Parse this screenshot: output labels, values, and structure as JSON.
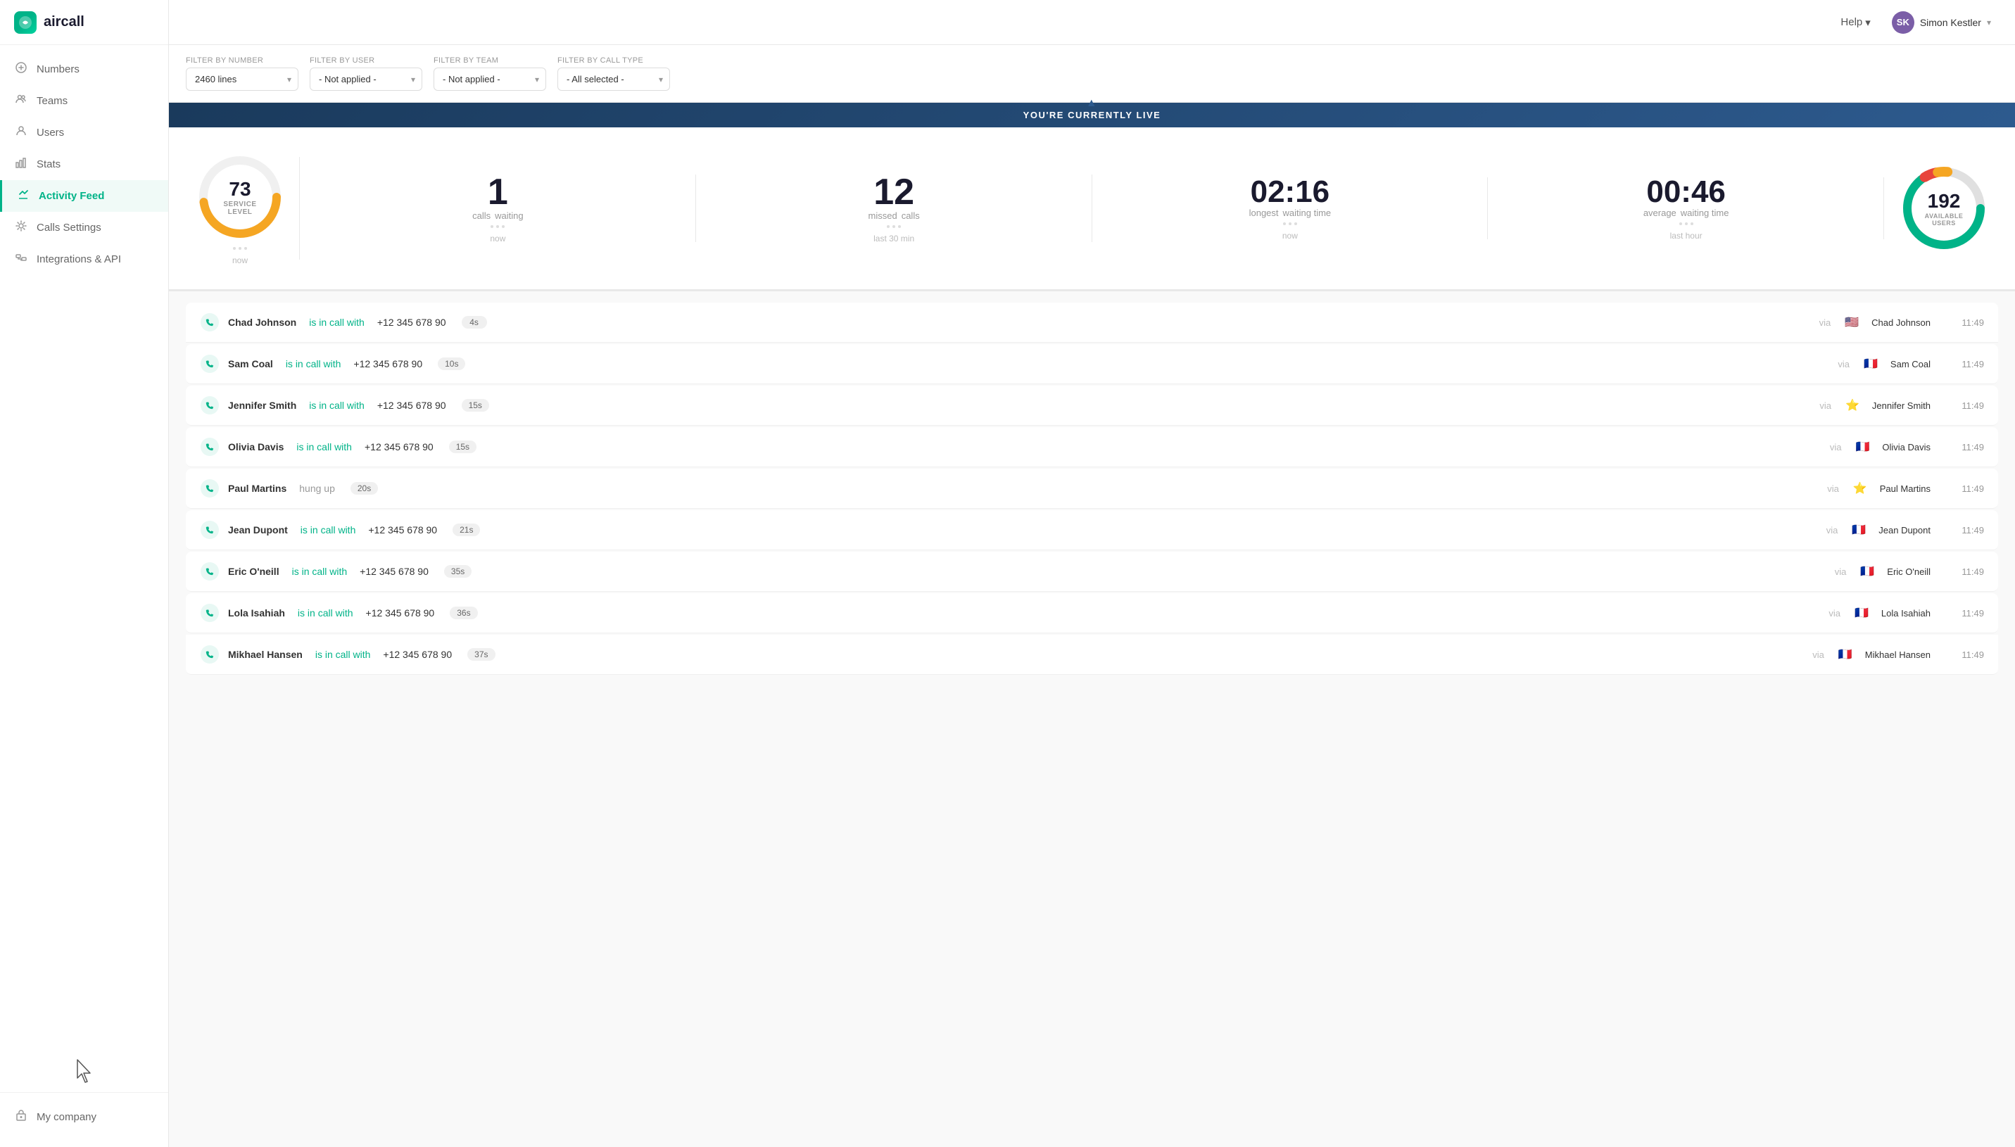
{
  "app": {
    "name": "aircall"
  },
  "topbar": {
    "help_label": "Help",
    "user_initials": "SK",
    "user_name": "Simon Kestler"
  },
  "sidebar": {
    "items": [
      {
        "id": "numbers",
        "label": "Numbers",
        "icon": "📞"
      },
      {
        "id": "teams",
        "label": "Teams",
        "icon": "👥"
      },
      {
        "id": "users",
        "label": "Users",
        "icon": "👤"
      },
      {
        "id": "stats",
        "label": "Stats",
        "icon": "📊"
      },
      {
        "id": "activity-feed",
        "label": "Activity Feed",
        "icon": "⚡",
        "active": true
      },
      {
        "id": "calls-settings",
        "label": "Calls Settings",
        "icon": "⚙️"
      },
      {
        "id": "integrations",
        "label": "Integrations & API",
        "icon": "🔗"
      }
    ],
    "bottom_item": {
      "id": "my-company",
      "label": "My company",
      "icon": "🏢"
    }
  },
  "filters": {
    "number_label": "Filter by number",
    "number_value": "2460 lines",
    "user_label": "Filter by user",
    "user_value": "- Not applied -",
    "team_label": "Filter by team",
    "team_value": "- Not applied -",
    "calltype_label": "Filter by call type",
    "calltype_value": "- All selected -"
  },
  "live_banner": "YOU'RE CURRENTLY LIVE",
  "stats": {
    "service_level": {
      "value": "73",
      "label": "SERVICE LEVEL",
      "sub": "• • •",
      "time": "now"
    },
    "calls_waiting": {
      "value": "1",
      "label1": "calls",
      "label2": "waiting",
      "sub": "• • •",
      "time": "now"
    },
    "missed_calls": {
      "value": "12",
      "label1": "missed",
      "label2": "calls",
      "sub": "• • •",
      "time": "last 30 min"
    },
    "longest_wait": {
      "value": "02:16",
      "label1": "longest",
      "label2": "waiting time",
      "sub": "• • •",
      "time": "now"
    },
    "avg_wait": {
      "value": "00:46",
      "label1": "average",
      "label2": "waiting time",
      "sub": "• • •",
      "time": "last hour"
    },
    "available_users": {
      "value": "192",
      "label": "AVAILABLE USERS"
    }
  },
  "activity_rows": [
    {
      "name": "Chad Johnson",
      "status": "is in call with",
      "number": "+12 345 678 90",
      "duration": "4s",
      "via": "via",
      "flag": "🇺🇸",
      "agent": "Chad Johnson",
      "time": "11:49"
    },
    {
      "name": "Sam Coal",
      "status": "is in call with",
      "number": "+12 345 678 90",
      "duration": "10s",
      "via": "via",
      "flag": "🇫🇷",
      "agent": "Sam Coal",
      "time": "11:49"
    },
    {
      "name": "Jennifer Smith",
      "status": "is in call with",
      "number": "+12 345 678 90",
      "duration": "15s",
      "via": "via",
      "flag": "⭐",
      "agent": "Jennifer Smith",
      "time": "11:49"
    },
    {
      "name": "Olivia Davis",
      "status": "is in call with",
      "number": "+12 345 678 90",
      "duration": "15s",
      "via": "via",
      "flag": "🇫🇷",
      "agent": "Olivia Davis",
      "time": "11:49"
    },
    {
      "name": "Paul Martins",
      "status": "hung up",
      "number": "",
      "duration": "20s",
      "via": "via",
      "flag": "⭐",
      "agent": "Paul Martins",
      "time": "11:49"
    },
    {
      "name": "Jean Dupont",
      "status": "is in call with",
      "number": "+12 345 678 90",
      "duration": "21s",
      "via": "via",
      "flag": "🇫🇷",
      "agent": "Jean Dupont",
      "time": "11:49"
    },
    {
      "name": "Eric O'neill",
      "status": "is in call with",
      "number": "+12 345 678 90",
      "duration": "35s",
      "via": "via",
      "flag": "🇫🇷",
      "agent": "Eric O'neill",
      "time": "11:49"
    },
    {
      "name": "Lola Isahiah",
      "status": "is in call with",
      "number": "+12 345 678 90",
      "duration": "36s",
      "via": "via",
      "flag": "🇫🇷",
      "agent": "Lola Isahiah",
      "time": "11:49"
    },
    {
      "name": "Mikhael Hansen",
      "status": "is in call with",
      "number": "+12 345 678 90",
      "duration": "37s",
      "via": "via",
      "flag": "🇫🇷",
      "agent": "Mikhael Hansen",
      "time": "11:49"
    }
  ],
  "colors": {
    "green": "#00b388",
    "brand": "#00b388",
    "orange": "#f5a623",
    "red": "#e8453c",
    "blue": "#2d5a8e",
    "purple": "#7b5ea7",
    "dark": "#1a1a2e",
    "gray": "#999"
  }
}
